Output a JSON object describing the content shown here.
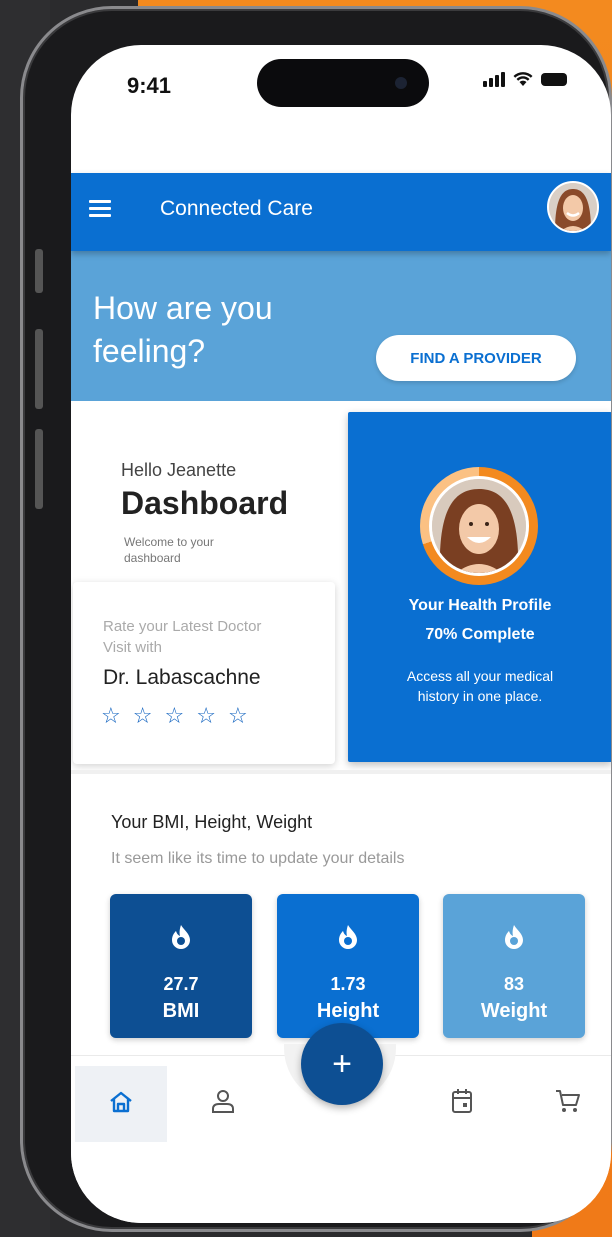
{
  "status_bar": {
    "time": "9:41"
  },
  "app_bar": {
    "title": "Connected Care"
  },
  "hero": {
    "question": "How are you feeling?",
    "cta_label": "FIND A PROVIDER"
  },
  "dashboard": {
    "greeting": "Hello Jeanette",
    "title": "Dashboard",
    "subtitle": "Welcome to your dashboard"
  },
  "rating_card": {
    "prompt": "Rate your Latest Doctor Visit with",
    "doctor": "Dr. Labascachne",
    "stars": 5,
    "rating": 0,
    "star_color": "#1565c0"
  },
  "profile_card": {
    "title": "Your Health Profile",
    "progress_label": "70% Complete",
    "progress": 0.7,
    "description": "Access all your medical history in one place.",
    "ring_color": "#f38a1f"
  },
  "metrics_section": {
    "title": "Your BMI, Height, Weight",
    "subtitle": "It seem like its time to update your details",
    "items": [
      {
        "value": "27.7",
        "label": "BMI",
        "icon": "flame-icon",
        "color": "#0d4f93"
      },
      {
        "value": "1.73",
        "label": "Height",
        "icon": "flame-icon",
        "color": "#0a6fd1"
      },
      {
        "value": "83",
        "label": "Weight",
        "icon": "flame-icon",
        "color": "#5aa3d8"
      }
    ]
  },
  "bottom_nav": {
    "items": [
      "home-icon",
      "profile-icon",
      "calendar-icon",
      "cart-icon"
    ],
    "fab_symbol": "+"
  },
  "colors": {
    "primary": "#0a6fd1",
    "hero": "#5aa3d8",
    "accent": "#f38a1f",
    "dark_blue": "#0d4f93"
  }
}
